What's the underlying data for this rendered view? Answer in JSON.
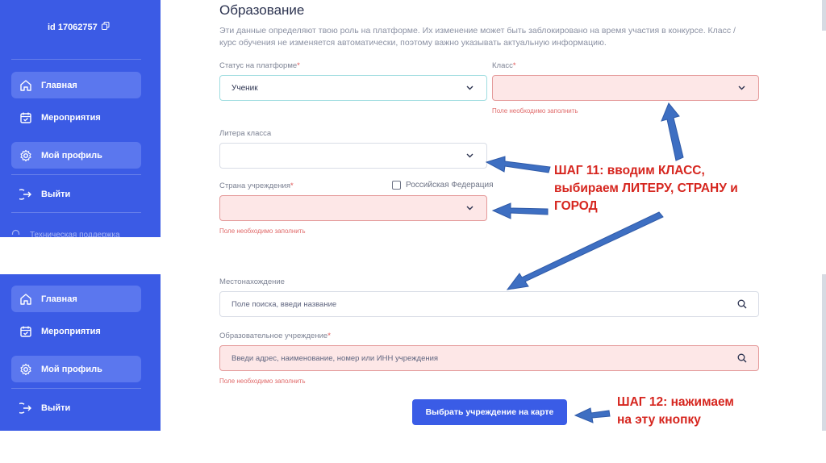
{
  "sidebar": {
    "user_id": "id 17062757",
    "nav": [
      {
        "label": "Главная",
        "icon": "home-icon"
      },
      {
        "label": "Мероприятия",
        "icon": "calendar-icon"
      },
      {
        "label": "Мой профиль",
        "icon": "gear-icon"
      },
      {
        "label": "Выйти",
        "icon": "logout-icon"
      }
    ],
    "support_label": "Техническая поддержка"
  },
  "education": {
    "title": "Образование",
    "description": "Эти данные определяют твою роль на платформе. Их изменение может быть заблокировано на время участия в конкурсе. Класс / курс обучения не изменяется автоматически, поэтому важно указывать актуальную информацию.",
    "status_label": "Статус на платформе",
    "status_value": "Ученик",
    "class_label": "Класс",
    "class_error": "Поле необходимо заполнить",
    "letter_label": "Литера класса",
    "country_label": "Страна учреждения",
    "country_checkbox_label": "Российская Федерация",
    "country_error": "Поле необходимо заполнить",
    "location_label": "Местонахождение",
    "location_placeholder": "Поле поиска, введи название",
    "institution_label": "Образовательное учреждение",
    "institution_placeholder": "Введи адрес, наименование, номер или ИНН учреждения",
    "institution_error": "Поле необходимо заполнить",
    "required_mark": "*",
    "map_button": "Выбрать учреждение на карте"
  },
  "annotations": {
    "step11_lines": [
      "ШАГ 11: вводим КЛАСС,",
      "выбираем ЛИТЕРУ, СТРАНУ и",
      "ГОРОД"
    ],
    "step12_lines": [
      "ШАГ 12: нажимаем",
      "на эту кнопку"
    ]
  },
  "colors": {
    "sidebar": "#3b5be5",
    "accent_button": "#3a5ce6",
    "error_fill": "#fde7e7",
    "annotation": "#d6261f",
    "arrow": "#3e6fc2"
  }
}
